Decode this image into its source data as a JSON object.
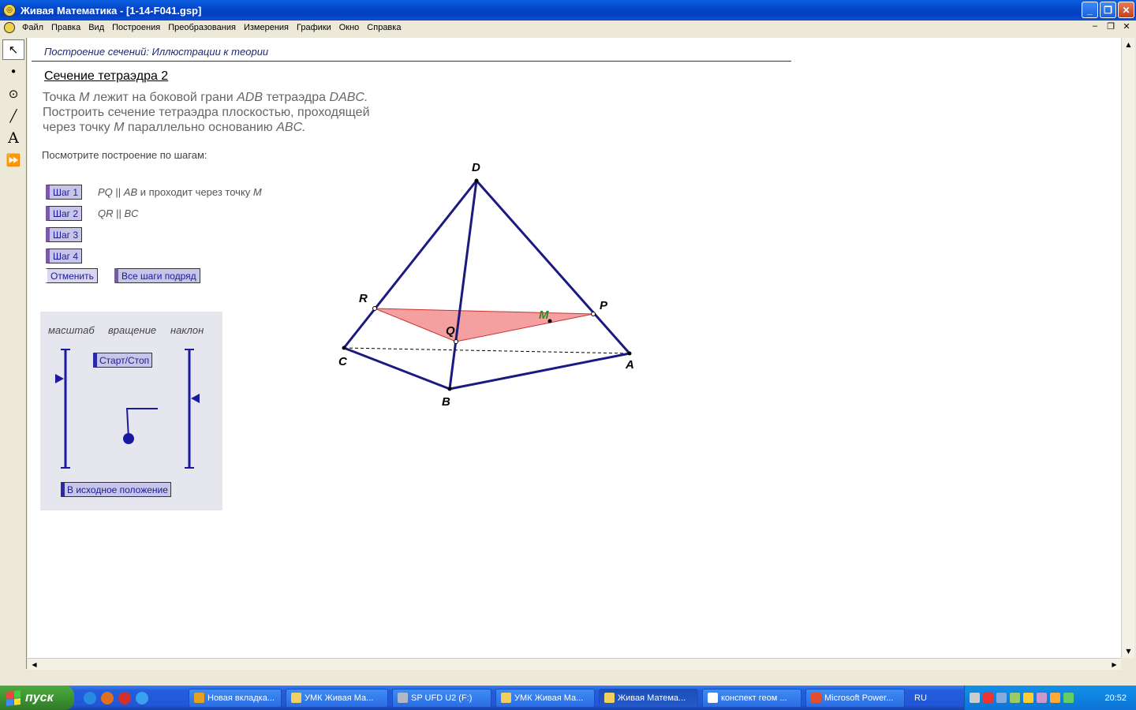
{
  "window": {
    "title": "Живая Математика - [1-14-F041.gsp]",
    "minimize": "_",
    "restore": "❐",
    "close": "✕"
  },
  "menu": [
    "Файл",
    "Правка",
    "Вид",
    "Построения",
    "Преобразования",
    "Измерения",
    "Графики",
    "Окно",
    "Справка"
  ],
  "mdi": {
    "minimize": "–",
    "restore": "❐",
    "close": "✕"
  },
  "tools": [
    {
      "name": "select-arrow-tool-icon",
      "glyph": "↖"
    },
    {
      "name": "point-tool-icon",
      "glyph": "•"
    },
    {
      "name": "compass-tool-icon",
      "glyph": "⊙"
    },
    {
      "name": "straightedge-tool-icon",
      "glyph": "╱"
    },
    {
      "name": "text-tool-icon",
      "glyph": "A"
    },
    {
      "name": "custom-tool-icon",
      "glyph": "⏩"
    }
  ],
  "document": {
    "header": "Построение сечений: Иллюстрации к теории",
    "title": "Сечение тетраэдра 2",
    "task_line1_a": "Точка ",
    "task_line1_M": "M",
    "task_line1_b": " лежит на боковой грани ",
    "task_line1_ADB": "ADB",
    "task_line1_c": " тетраэдра ",
    "task_line1_DABC": "DABC.",
    "task_line2": "Построить сечение тетраэдра плоскостью, проходящей",
    "task_line3_a": "через точку ",
    "task_line3_M": "M",
    "task_line3_b": "  параллельно основанию ",
    "task_line3_ABC": "ABC.",
    "prompt": "Посмотрите построение по шагам:"
  },
  "steps": [
    {
      "label": "Шаг 1",
      "note_i1": "PQ",
      "note_mid": " || ",
      "note_i2": "AB",
      "note_tail": " и проходит через точку ",
      "note_i3": "M"
    },
    {
      "label": "Шаг 2",
      "note_i1": "QR",
      "note_mid": " || ",
      "note_i2": "BC",
      "note_tail": "",
      "note_i3": ""
    },
    {
      "label": "Шаг 3"
    },
    {
      "label": "Шаг 4"
    }
  ],
  "buttons": {
    "undo": "Отменить",
    "all_steps": "Все шаги подряд"
  },
  "controls": {
    "scale_label": "масштаб",
    "rotation_label": "вращение",
    "tilt_label": "наклон",
    "start_stop": "Старт/Стоп",
    "reset": "В исходное положение"
  },
  "points": {
    "D": "D",
    "R": "R",
    "P": "P",
    "Q": "Q",
    "M": "M",
    "C": "C",
    "A": "A",
    "B": "B"
  },
  "colors": {
    "edge": "#1a1a80",
    "section_fill": "#f4a0a0",
    "section_stroke": "#cc3333",
    "point_M": "#2a8a2a",
    "control": "#1a1aa0"
  },
  "taskbar": {
    "start": "пуск",
    "items": [
      {
        "label": "Новая вкладка...",
        "icon": "#e8a020",
        "active": false
      },
      {
        "label": "УМК Живая Ма...",
        "icon": "#f0d060",
        "active": false
      },
      {
        "label": "SP UFD U2 (F:)",
        "icon": "#b0b8c8",
        "active": false
      },
      {
        "label": "УМК Живая Ма...",
        "icon": "#f0d060",
        "active": false
      },
      {
        "label": "Живая Матема...",
        "icon": "#f0d060",
        "active": true
      },
      {
        "label": "конспект геом ...",
        "icon": "#ffffff",
        "active": false
      },
      {
        "label": "Microsoft Power...",
        "icon": "#e05030",
        "active": false
      }
    ],
    "lang": "RU",
    "clock": "20:52"
  }
}
